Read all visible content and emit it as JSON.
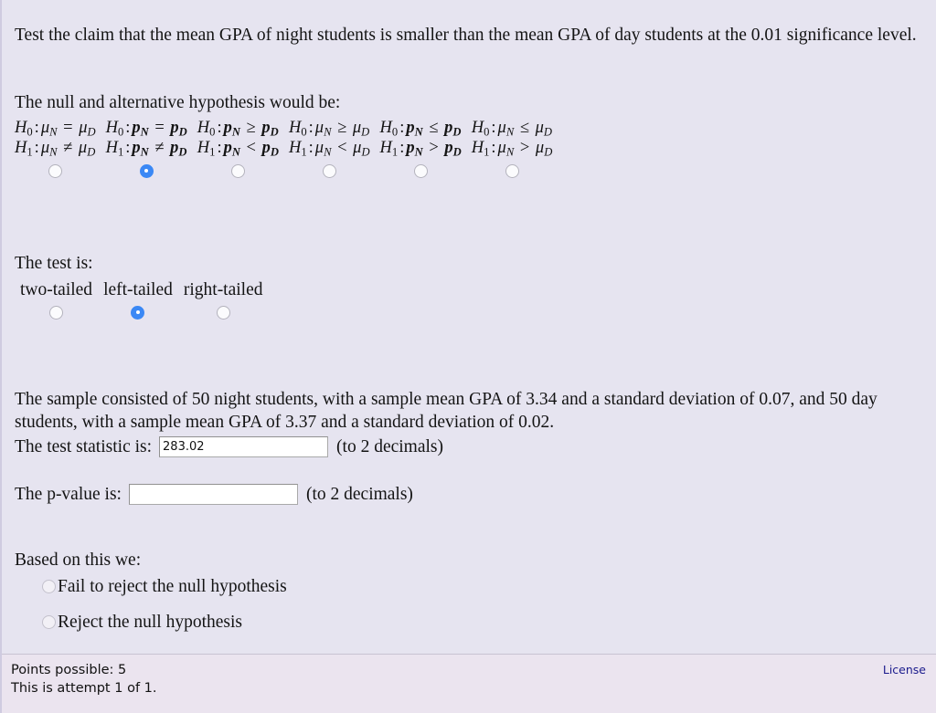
{
  "question": {
    "claim": "Test the claim that the mean GPA of night students is smaller than the mean GPA of day students at the 0.01 significance level.",
    "hypothesis_intro": "The null and alternative hypothesis would be:",
    "test_is_label": "The test is:",
    "sample_description": "The sample consisted of 50 night students, with a sample mean GPA of 3.34 and a standard deviation of 0.07, and 50 day students, with a sample mean GPA of 3.37 and a standard deviation of 0.02.",
    "conclusion_intro": "Based on this we:"
  },
  "hypothesis_options": [
    {
      "null_symbol": "H",
      "null_sub": "0",
      "alt_symbol": "H",
      "alt_sub": "1",
      "null_param": "μ",
      "null_param_style": "italic",
      "null_left_sub": "N",
      "null_right_sub": "D",
      "null_relation": "=",
      "alt_relation": "≠",
      "selected": false
    },
    {
      "null_symbol": "H",
      "null_sub": "0",
      "alt_symbol": "H",
      "alt_sub": "1",
      "null_param": "p",
      "null_param_style": "bold-italic",
      "null_left_sub": "N",
      "null_right_sub": "D",
      "null_relation": "=",
      "alt_relation": "≠",
      "selected": true
    },
    {
      "null_symbol": "H",
      "null_sub": "0",
      "alt_symbol": "H",
      "alt_sub": "1",
      "null_param": "p",
      "null_param_style": "bold-italic",
      "null_left_sub": "N",
      "null_right_sub": "D",
      "null_relation": "≥",
      "alt_relation": "<",
      "selected": false
    },
    {
      "null_symbol": "H",
      "null_sub": "0",
      "alt_symbol": "H",
      "alt_sub": "1",
      "null_param": "μ",
      "null_param_style": "italic",
      "null_left_sub": "N",
      "null_right_sub": "D",
      "null_relation": "≥",
      "alt_relation": "<",
      "selected": false
    },
    {
      "null_symbol": "H",
      "null_sub": "0",
      "alt_symbol": "H",
      "alt_sub": "1",
      "null_param": "p",
      "null_param_style": "bold-italic",
      "null_left_sub": "N",
      "null_right_sub": "D",
      "null_relation": "≤",
      "alt_relation": ">",
      "selected": false
    },
    {
      "null_symbol": "H",
      "null_sub": "0",
      "alt_symbol": "H",
      "alt_sub": "1",
      "null_param": "μ",
      "null_param_style": "italic",
      "null_left_sub": "N",
      "null_right_sub": "D",
      "null_relation": "≤",
      "alt_relation": ">",
      "selected": false
    }
  ],
  "tail_options": [
    {
      "label": "two-tailed",
      "selected": false
    },
    {
      "label": "left-tailed",
      "selected": true
    },
    {
      "label": "right-tailed",
      "selected": false
    }
  ],
  "fields": {
    "test_statistic": {
      "label": "The test statistic is:",
      "value": "283.02",
      "hint": "(to 2 decimals)"
    },
    "p_value": {
      "label": "The p-value is:",
      "value": "",
      "hint": "(to 2 decimals)"
    }
  },
  "conclusion_options": [
    {
      "label": "Fail to reject the null hypothesis",
      "selected": false
    },
    {
      "label": "Reject the null hypothesis",
      "selected": false
    }
  ],
  "footer": {
    "points_possible": "Points possible: 5",
    "attempt": "This is attempt 1 of 1.",
    "license_label": "License"
  },
  "colors": {
    "page_background": "#e6e4f0",
    "footer_background": "#ebe4ef",
    "radio_selected": "#3b88f5",
    "link": "#1a1a8c",
    "text": "#141414"
  }
}
